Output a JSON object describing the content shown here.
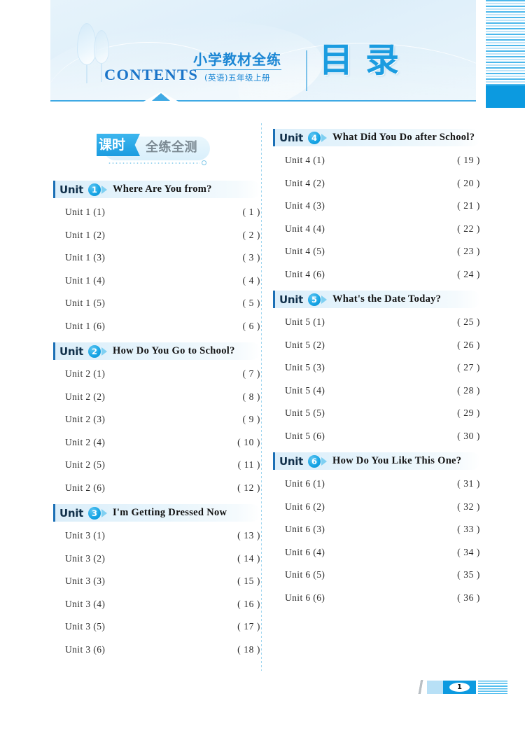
{
  "header": {
    "contents_label": "CONTENTS",
    "title_cn_main": "小学教材全练",
    "title_cn_sub": "(英语)五年级上册",
    "title_mulu": "目录"
  },
  "section_badge": {
    "tag": "课时",
    "text": "全练全测"
  },
  "columns": {
    "left": [
      {
        "unit_word": "Unit",
        "unit_number": "1",
        "unit_title": "Where Are You from?",
        "entries": [
          {
            "label": "Unit 1 (1)",
            "page": "( 1 )"
          },
          {
            "label": "Unit 1 (2)",
            "page": "( 2 )"
          },
          {
            "label": "Unit 1 (3)",
            "page": "( 3 )"
          },
          {
            "label": "Unit 1 (4)",
            "page": "( 4 )"
          },
          {
            "label": "Unit 1 (5)",
            "page": "( 5 )"
          },
          {
            "label": "Unit 1 (6)",
            "page": "( 6 )"
          }
        ]
      },
      {
        "unit_word": "Unit",
        "unit_number": "2",
        "unit_title": "How Do You Go to School?",
        "entries": [
          {
            "label": "Unit 2 (1)",
            "page": "( 7 )"
          },
          {
            "label": "Unit 2 (2)",
            "page": "( 8 )"
          },
          {
            "label": "Unit 2 (3)",
            "page": "( 9 )"
          },
          {
            "label": "Unit 2 (4)",
            "page": "( 10 )"
          },
          {
            "label": "Unit 2 (5)",
            "page": "( 11 )"
          },
          {
            "label": "Unit 2 (6)",
            "page": "( 12 )"
          }
        ]
      },
      {
        "unit_word": "Unit",
        "unit_number": "3",
        "unit_title": "I'm Getting Dressed Now",
        "entries": [
          {
            "label": "Unit 3 (1)",
            "page": "( 13 )"
          },
          {
            "label": "Unit 3 (2)",
            "page": "( 14 )"
          },
          {
            "label": "Unit 3 (3)",
            "page": "( 15 )"
          },
          {
            "label": "Unit 3 (4)",
            "page": "( 16 )"
          },
          {
            "label": "Unit 3 (5)",
            "page": "( 17 )"
          },
          {
            "label": "Unit 3 (6)",
            "page": "( 18 )"
          }
        ]
      }
    ],
    "right": [
      {
        "unit_word": "Unit",
        "unit_number": "4",
        "unit_title": "What Did You Do after School?",
        "entries": [
          {
            "label": "Unit 4 (1)",
            "page": "( 19 )"
          },
          {
            "label": "Unit 4 (2)",
            "page": "( 20 )"
          },
          {
            "label": "Unit 4 (3)",
            "page": "( 21 )"
          },
          {
            "label": "Unit 4 (4)",
            "page": "( 22 )"
          },
          {
            "label": "Unit 4 (5)",
            "page": "( 23 )"
          },
          {
            "label": "Unit 4 (6)",
            "page": "( 24 )"
          }
        ]
      },
      {
        "unit_word": "Unit",
        "unit_number": "5",
        "unit_title": "What's the Date Today?",
        "entries": [
          {
            "label": "Unit 5 (1)",
            "page": "( 25 )"
          },
          {
            "label": "Unit 5 (2)",
            "page": "( 26 )"
          },
          {
            "label": "Unit 5 (3)",
            "page": "( 27 )"
          },
          {
            "label": "Unit 5 (4)",
            "page": "( 28 )"
          },
          {
            "label": "Unit 5 (5)",
            "page": "( 29 )"
          },
          {
            "label": "Unit 5 (6)",
            "page": "( 30 )"
          }
        ]
      },
      {
        "unit_word": "Unit",
        "unit_number": "6",
        "unit_title": "How Do You Like This One?",
        "entries": [
          {
            "label": "Unit 6 (1)",
            "page": "( 31 )"
          },
          {
            "label": "Unit 6 (2)",
            "page": "( 32 )"
          },
          {
            "label": "Unit 6 (3)",
            "page": "( 33 )"
          },
          {
            "label": "Unit 6 (4)",
            "page": "( 34 )"
          },
          {
            "label": "Unit 6 (5)",
            "page": "( 35 )"
          },
          {
            "label": "Unit 6 (6)",
            "page": "( 36 )"
          }
        ]
      }
    ]
  },
  "footer": {
    "page_number": "1"
  },
  "colors": {
    "accent_blue": "#0c9ae0",
    "deep_blue": "#1b6fb5",
    "band_bg": "#e3f1fb",
    "rule": "#3fa9e4"
  }
}
